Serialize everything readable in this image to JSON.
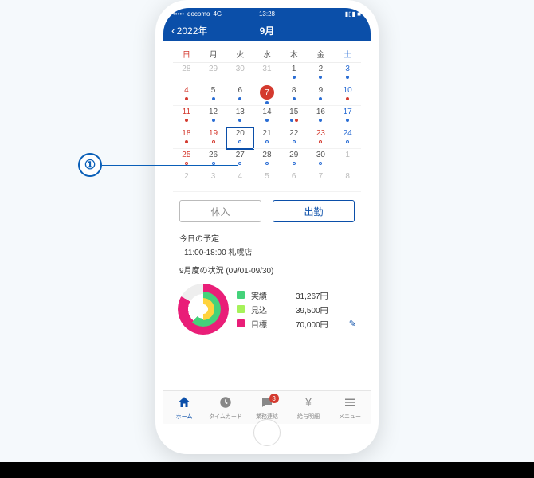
{
  "callout": {
    "number": "①"
  },
  "status": {
    "carrier": "docomo",
    "network": "4G",
    "time": "13:28"
  },
  "header": {
    "back_label": "2022年",
    "title": "9月"
  },
  "calendar": {
    "dow": [
      "日",
      "月",
      "火",
      "水",
      "木",
      "金",
      "土"
    ],
    "weeks": [
      [
        {
          "n": "28",
          "cls": "other"
        },
        {
          "n": "29",
          "cls": "other"
        },
        {
          "n": "30",
          "cls": "other"
        },
        {
          "n": "31",
          "cls": "other"
        },
        {
          "n": "1",
          "cls": "",
          "dots": [
            "filled-blue"
          ]
        },
        {
          "n": "2",
          "cls": "",
          "dots": [
            "filled-blue"
          ]
        },
        {
          "n": "3",
          "cls": "sat",
          "dots": [
            "filled-blue"
          ]
        }
      ],
      [
        {
          "n": "4",
          "cls": "sun",
          "dots": [
            "filled-red"
          ]
        },
        {
          "n": "5",
          "cls": "",
          "dots": [
            "filled-blue"
          ]
        },
        {
          "n": "6",
          "cls": "",
          "dots": [
            "filled-blue"
          ]
        },
        {
          "n": "7",
          "cls": "",
          "today": true,
          "dots": [
            "filled-blue"
          ]
        },
        {
          "n": "8",
          "cls": "",
          "dots": [
            "filled-blue"
          ]
        },
        {
          "n": "9",
          "cls": "",
          "dots": [
            "filled-blue"
          ]
        },
        {
          "n": "10",
          "cls": "sat",
          "dots": [
            "filled-red"
          ]
        }
      ],
      [
        {
          "n": "11",
          "cls": "sun",
          "dots": [
            "filled-red"
          ]
        },
        {
          "n": "12",
          "cls": "",
          "dots": [
            "filled-blue"
          ]
        },
        {
          "n": "13",
          "cls": "",
          "dots": [
            "filled-blue"
          ]
        },
        {
          "n": "14",
          "cls": "",
          "dots": [
            "filled-blue"
          ]
        },
        {
          "n": "15",
          "cls": "",
          "dots": [
            "filled-blue",
            "filled-red"
          ]
        },
        {
          "n": "16",
          "cls": "",
          "dots": [
            "filled-blue"
          ]
        },
        {
          "n": "17",
          "cls": "sat",
          "dots": [
            "filled-blue"
          ]
        }
      ],
      [
        {
          "n": "18",
          "cls": "sun",
          "dots": [
            "filled-red"
          ]
        },
        {
          "n": "19",
          "cls": "hol",
          "dots": [
            "open-red"
          ]
        },
        {
          "n": "20",
          "cls": "",
          "selected": true,
          "dots": [
            "open-blue"
          ]
        },
        {
          "n": "21",
          "cls": "",
          "dots": [
            "open-blue"
          ]
        },
        {
          "n": "22",
          "cls": "",
          "dots": [
            "open-blue"
          ]
        },
        {
          "n": "23",
          "cls": "hol",
          "dots": [
            "open-red"
          ]
        },
        {
          "n": "24",
          "cls": "sat",
          "dots": [
            "open-blue"
          ]
        }
      ],
      [
        {
          "n": "25",
          "cls": "sun",
          "dots": [
            "open-red"
          ]
        },
        {
          "n": "26",
          "cls": "",
          "dots": [
            "open-blue"
          ]
        },
        {
          "n": "27",
          "cls": "",
          "dots": [
            "open-blue"
          ]
        },
        {
          "n": "28",
          "cls": "",
          "dots": [
            "open-blue"
          ]
        },
        {
          "n": "29",
          "cls": "",
          "dots": [
            "open-blue"
          ]
        },
        {
          "n": "30",
          "cls": "",
          "dots": [
            "open-blue"
          ]
        },
        {
          "n": "1",
          "cls": "other"
        }
      ],
      [
        {
          "n": "2",
          "cls": "other"
        },
        {
          "n": "3",
          "cls": "other"
        },
        {
          "n": "4",
          "cls": "other"
        },
        {
          "n": "5",
          "cls": "other"
        },
        {
          "n": "6",
          "cls": "other"
        },
        {
          "n": "7",
          "cls": "other"
        },
        {
          "n": "8",
          "cls": "other"
        }
      ]
    ]
  },
  "actions": {
    "left": "休入",
    "right": "出勤"
  },
  "today_plan": {
    "title": "今日の予定",
    "body": "11:00-18:00 札幌店"
  },
  "month_status": {
    "title": "9月度の状況 (09/01-09/30)",
    "legend": [
      {
        "color": "#44d27a",
        "label": "実績",
        "value": "31,267円"
      },
      {
        "color": "#a6f25a",
        "label": "見込",
        "value": "39,500円"
      },
      {
        "color": "#e91e78",
        "label": "目標",
        "value": "70,000円",
        "editable": true
      }
    ]
  },
  "tabs": [
    {
      "icon": "home-icon",
      "label": "ホーム",
      "active": true
    },
    {
      "icon": "clock-icon",
      "label": "タイムカード"
    },
    {
      "icon": "chat-icon",
      "label": "業務連絡",
      "badge": "3"
    },
    {
      "icon": "yen-icon",
      "label": "給与明細"
    },
    {
      "icon": "menu-icon",
      "label": "メニュー"
    }
  ]
}
